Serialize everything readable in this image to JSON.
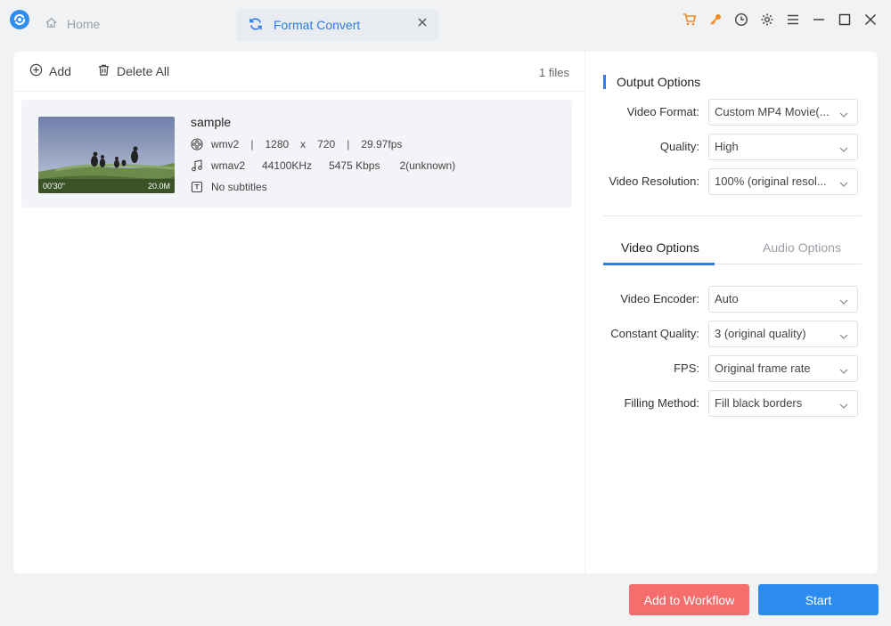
{
  "tabs": {
    "home": "Home",
    "active": "Format Convert"
  },
  "toolbar": {
    "add": "Add",
    "delete_all": "Delete All",
    "files_count": "1 files"
  },
  "file": {
    "name": "sample",
    "duration": "00'30\"",
    "size": "20.0M",
    "video": {
      "codec": "wmv2",
      "width": "1280",
      "x": "x",
      "height": "720",
      "fps": "29.97fps"
    },
    "audio": {
      "codec": "wmav2",
      "sample_rate": "44100KHz",
      "bitrate": "5475 Kbps",
      "channels": "2(unknown)"
    },
    "subtitles": "No subtitles"
  },
  "output_options": {
    "title": "Output Options",
    "video_format": {
      "label": "Video Format:",
      "value": "Custom MP4 Movie(..."
    },
    "quality": {
      "label": "Quality:",
      "value": "High"
    },
    "video_resolution": {
      "label": "Video Resolution:",
      "value": "100% (original resol..."
    }
  },
  "subtabs": {
    "video": "Video Options",
    "audio": "Audio Options"
  },
  "video_options": {
    "encoder": {
      "label": "Video Encoder:",
      "value": "Auto"
    },
    "constant_quality": {
      "label": "Constant Quality:",
      "value": "3 (original quality)"
    },
    "fps": {
      "label": "FPS:",
      "value": "Original frame rate"
    },
    "filling": {
      "label": "Filling Method:",
      "value": "Fill black borders"
    }
  },
  "buttons": {
    "workflow": "Add to Workflow",
    "start": "Start"
  },
  "colors": {
    "accent": "#2f7de1",
    "start": "#2d8cf0",
    "workflow": "#f56d6d",
    "cart": "#f08a24",
    "key": "#f08a24"
  },
  "icons": [
    "app-logo-icon",
    "home-icon",
    "refresh-icon",
    "close-icon",
    "cart-icon",
    "key-icon",
    "clock-icon",
    "gear-icon",
    "menu-icon",
    "minimize-icon",
    "maximize-icon",
    "window-close-icon",
    "add-icon",
    "trash-icon",
    "film-icon",
    "music-icon",
    "subtitle-icon",
    "chevron-down-icon"
  ]
}
